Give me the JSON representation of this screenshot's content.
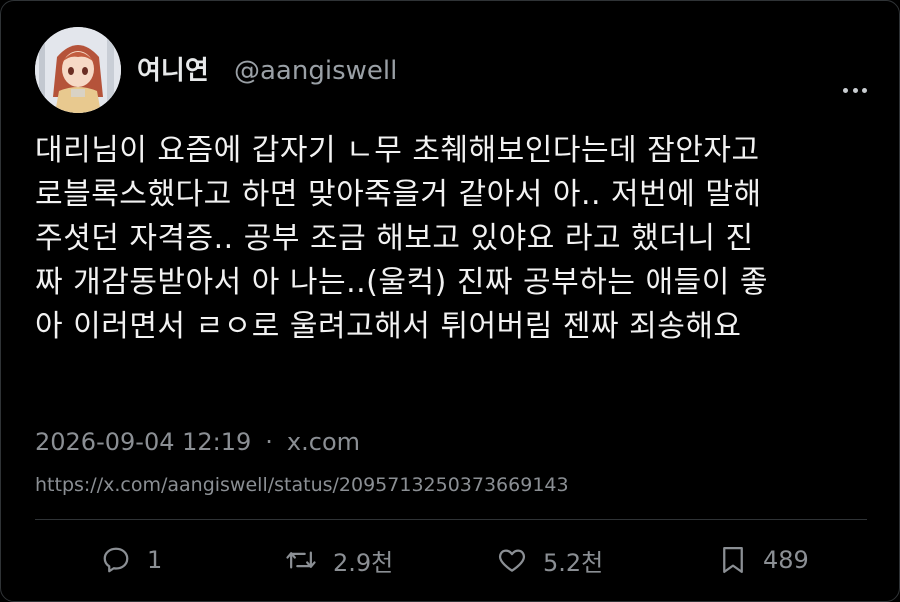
{
  "header": {
    "display_name": "여니연",
    "handle": "@aangiswell"
  },
  "tweet": {
    "lines": [
      "대리님이 요즘에 갑자기 ㄴ무 초췌해보인다는데 잠안자고",
      "로블록스했다고 하면 맞아죽을거 같아서 아.. 저번에 말해",
      "주셧던 자격증.. 공부 조금 해보고 있야요 라고 했더니 진",
      "짜 개감동받아서 아 나는..(울컥) 진짜 공부하는 애들이 좋",
      "아 이러면서 ㄹㅇ로 울려고해서 튀어버림 젠짜 죄송해요"
    ]
  },
  "meta": {
    "timestamp": "2026-09-04 12:19",
    "separator": "·",
    "source": "x.com",
    "url": "https://x.com/aangiswell/status/2095713250373669143"
  },
  "actions": {
    "reply_count": "1",
    "retweet_count": "2.9천",
    "like_count": "5.2천",
    "bookmark_count": "489"
  },
  "icons": {
    "reply": "reply-icon",
    "retweet": "retweet-icon",
    "like": "heart-icon",
    "bookmark": "bookmark-icon",
    "more": "more-icon"
  },
  "colors": {
    "background": "#000000",
    "text": "#e7e9ea",
    "muted": "#8b8f94",
    "border": "#2f3336"
  }
}
